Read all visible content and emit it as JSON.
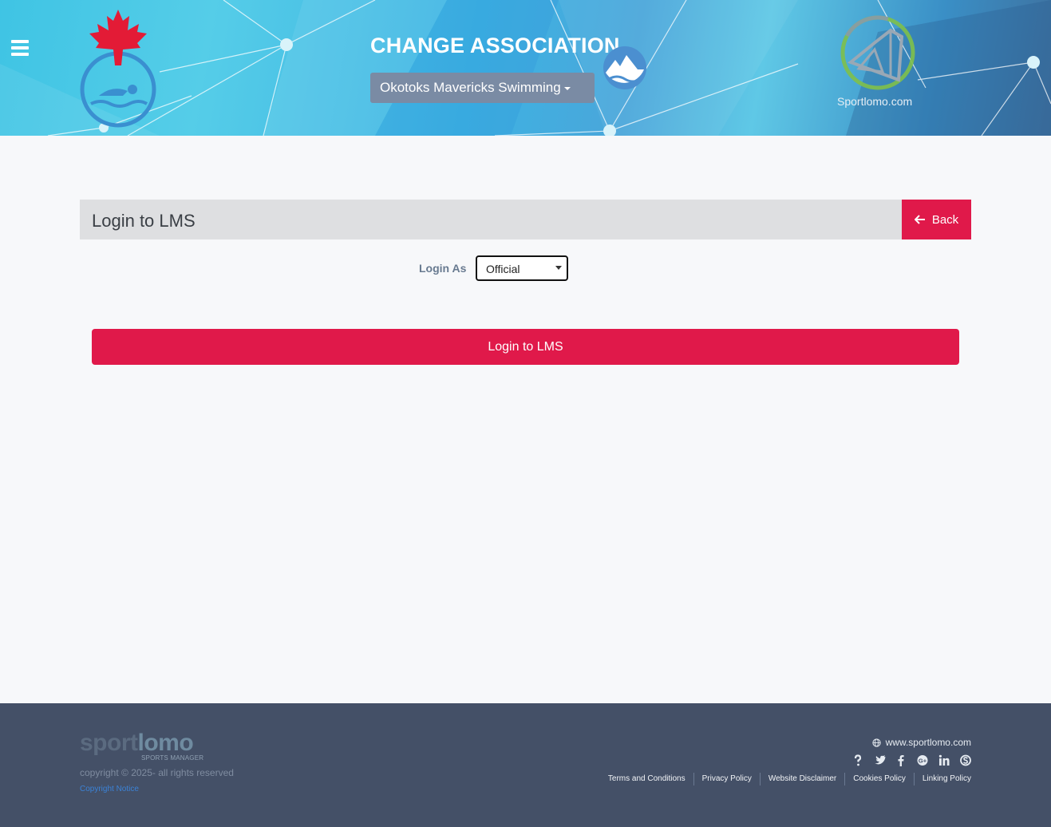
{
  "header": {
    "title": "CHANGE ASSOCIATION",
    "association_selected": "Okotoks Mavericks Swimming",
    "brand_text": "Sportlomo.com",
    "icons": {
      "menu": "hamburger-menu-icon",
      "left_logo": "swimming-canada-logo",
      "club_logo": "club-mountain-logo",
      "brand_logo": "sportlomo-logo"
    }
  },
  "main": {
    "panel_title": "Login to LMS",
    "back_label": "Back",
    "login_as_label": "Login As",
    "login_as_value": "Official",
    "submit_label": "Login to LMS"
  },
  "footer": {
    "logo_word_a": "sport",
    "logo_word_b": "lomo",
    "logo_sub": "SPORTS MANAGER",
    "copyright": "copyright © 2025- all rights reserved",
    "copyright_notice": "Copyright Notice",
    "website": "www.sportlomo.com",
    "social_icons": [
      "help-icon",
      "twitter-icon",
      "facebook-icon",
      "google-plus-icon",
      "linkedin-icon",
      "skype-icon"
    ],
    "links": [
      "Terms and Conditions",
      "Privacy Policy",
      "Website Disclaimer",
      "Cookies Policy",
      "Linking Policy"
    ]
  },
  "colors": {
    "accent": "#e0194a",
    "footer_bg": "#445067",
    "page_bg": "#f7f8fa",
    "dropdown_bg": "#7a8ba4"
  }
}
